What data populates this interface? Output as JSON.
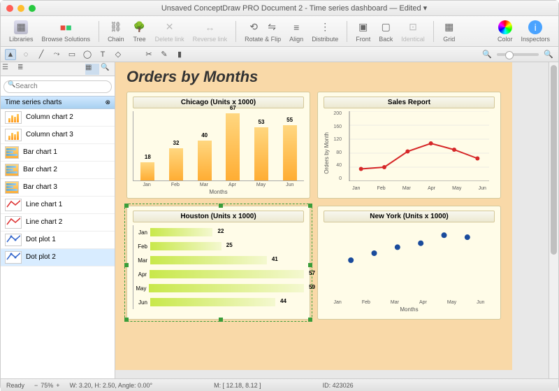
{
  "window": {
    "title": "Unsaved ConceptDraw PRO Document 2 - Time series dashboard — Edited ▾"
  },
  "toolbar": {
    "libraries": "Libraries",
    "browse": "Browse Solutions",
    "chain": "Chain",
    "tree": "Tree",
    "delete_link": "Delete link",
    "reverse_link": "Reverse link",
    "rotate_flip": "Rotate & Flip",
    "align": "Align",
    "distribute": "Distribute",
    "front": "Front",
    "back": "Back",
    "identical": "Identical",
    "grid": "Grid",
    "color": "Color",
    "inspectors": "Inspectors"
  },
  "search": {
    "placeholder": "Search"
  },
  "library": {
    "header": "Time series charts",
    "items": [
      {
        "label": "Column chart 2"
      },
      {
        "label": "Column chart 3"
      },
      {
        "label": "Bar chart 1"
      },
      {
        "label": "Bar chart 2"
      },
      {
        "label": "Bar chart 3"
      },
      {
        "label": "Line chart 1"
      },
      {
        "label": "Line chart 2"
      },
      {
        "label": "Dot plot 1"
      },
      {
        "label": "Dot plot 2"
      }
    ]
  },
  "page": {
    "title": "Orders by Months"
  },
  "chart_data": [
    {
      "type": "bar",
      "title": "Chicago (Units x 1000)",
      "categories": [
        "Jan",
        "Feb",
        "Mar",
        "Apr",
        "May",
        "Jun"
      ],
      "values": [
        18,
        32,
        40,
        67,
        53,
        55
      ],
      "xlabel": "Months",
      "ylabel": "",
      "ylim": [
        0,
        70
      ]
    },
    {
      "type": "line",
      "title": "Sales Report",
      "categories": [
        "Jan",
        "Feb",
        "Mar",
        "Apr",
        "May",
        "Jun"
      ],
      "values": [
        35,
        40,
        85,
        108,
        90,
        65
      ],
      "xlabel": "",
      "ylabel": "Orders by Month",
      "ylim": [
        0,
        200
      ],
      "yticks": [
        0,
        40,
        80,
        120,
        160,
        200
      ]
    },
    {
      "type": "bar",
      "orientation": "horizontal",
      "title": "Houston (Units x 1000)",
      "categories": [
        "Jan",
        "Feb",
        "Mar",
        "Apr",
        "May",
        "Jun"
      ],
      "values": [
        22,
        25,
        41,
        57,
        59,
        44
      ],
      "xlabel": "",
      "ylabel": "",
      "xlim": [
        0,
        60
      ]
    },
    {
      "type": "scatter",
      "title": "New York (Units x 1000)",
      "categories": [
        "Jan",
        "Feb",
        "Mar",
        "Apr",
        "May",
        "Jun"
      ],
      "values": [
        35,
        42,
        48,
        52,
        60,
        58
      ],
      "xlabel": "Months",
      "ylabel": "",
      "ylim": [
        0,
        70
      ]
    }
  ],
  "status": {
    "ready": "Ready",
    "zoom": "75%",
    "dims": "W: 3.20, H: 2.50, Angle: 0.00°",
    "m": "M: [ 12.18, 8.12 ]",
    "id": "ID: 423026"
  }
}
